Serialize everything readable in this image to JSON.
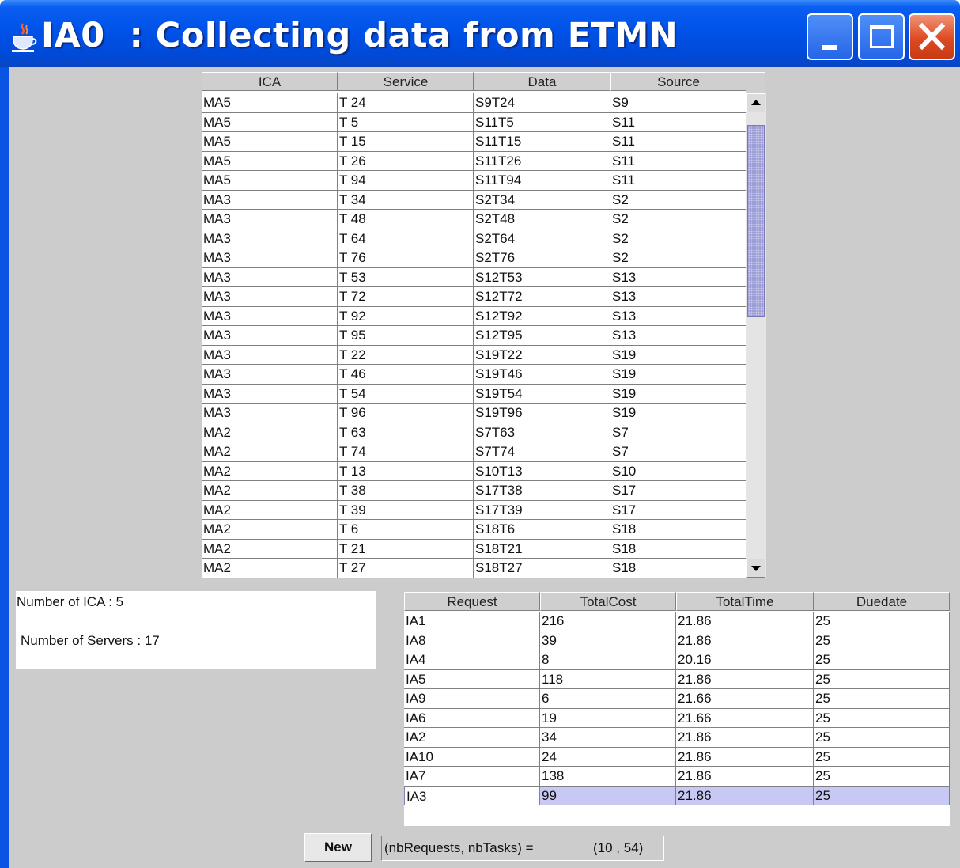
{
  "window": {
    "title": "IA0  : Collecting data from ETMN",
    "icon": "java-cup-icon",
    "controls": [
      "minimize",
      "maximize",
      "close"
    ]
  },
  "services_table": {
    "columns": [
      "ICA",
      "Service",
      "Data",
      "Source"
    ],
    "rows": [
      [
        "MA5",
        "T 24",
        "S9T24",
        "S9"
      ],
      [
        "MA5",
        "T 5",
        "S11T5",
        "S11"
      ],
      [
        "MA5",
        "T 15",
        "S11T15",
        "S11"
      ],
      [
        "MA5",
        "T 26",
        "S11T26",
        "S11"
      ],
      [
        "MA5",
        "T 94",
        "S11T94",
        "S11"
      ],
      [
        "MA3",
        "T 34",
        "S2T34",
        "S2"
      ],
      [
        "MA3",
        "T 48",
        "S2T48",
        "S2"
      ],
      [
        "MA3",
        "T 64",
        "S2T64",
        "S2"
      ],
      [
        "MA3",
        "T 76",
        "S2T76",
        "S2"
      ],
      [
        "MA3",
        "T 53",
        "S12T53",
        "S13"
      ],
      [
        "MA3",
        "T 72",
        "S12T72",
        "S13"
      ],
      [
        "MA3",
        "T 92",
        "S12T92",
        "S13"
      ],
      [
        "MA3",
        "T 95",
        "S12T95",
        "S13"
      ],
      [
        "MA3",
        "T 22",
        "S19T22",
        "S19"
      ],
      [
        "MA3",
        "T 46",
        "S19T46",
        "S19"
      ],
      [
        "MA3",
        "T 54",
        "S19T54",
        "S19"
      ],
      [
        "MA3",
        "T 96",
        "S19T96",
        "S19"
      ],
      [
        "MA2",
        "T 63",
        "S7T63",
        "S7"
      ],
      [
        "MA2",
        "T 74",
        "S7T74",
        "S7"
      ],
      [
        "MA2",
        "T 13",
        "S10T13",
        "S10"
      ],
      [
        "MA2",
        "T 38",
        "S17T38",
        "S17"
      ],
      [
        "MA2",
        "T 39",
        "S17T39",
        "S17"
      ],
      [
        "MA2",
        "T 6",
        "S18T6",
        "S18"
      ],
      [
        "MA2",
        "T 21",
        "S18T21",
        "S18"
      ],
      [
        "MA2",
        "T 27",
        "S18T27",
        "S18"
      ]
    ],
    "scroll_position": 0.05,
    "scroll_visible_fraction": 0.43
  },
  "info": {
    "number_of_ica": "Number of ICA : 5",
    "number_of_servers": "Number of Servers : 17"
  },
  "requests_table": {
    "columns": [
      "Request",
      "TotalCost",
      "TotalTime",
      "Duedate"
    ],
    "rows": [
      [
        "IA1",
        "216",
        "21.86",
        "25"
      ],
      [
        "IA8",
        "39",
        "21.86",
        "25"
      ],
      [
        "IA4",
        "8",
        "20.16",
        "25"
      ],
      [
        "IA5",
        "118",
        "21.86",
        "25"
      ],
      [
        "IA9",
        "6",
        "21.66",
        "25"
      ],
      [
        "IA6",
        "19",
        "21.66",
        "25"
      ],
      [
        "IA2",
        "34",
        "21.86",
        "25"
      ],
      [
        "IA10",
        "24",
        "21.86",
        "25"
      ],
      [
        "IA7",
        "138",
        "21.86",
        "25"
      ],
      [
        "IA3",
        "99",
        "21.86",
        "25"
      ]
    ],
    "selected_row": 9
  },
  "footer": {
    "new_button": "New",
    "status_label": "(nbRequests, nbTasks) =",
    "status_value": "(10 , 54)"
  },
  "colors": {
    "titlebar": "#0052e8",
    "panel": "#cccccc",
    "selection": "#c8c8f4",
    "scroll_thumb": "#9d9dd6",
    "close_button": "#dd4a22"
  }
}
